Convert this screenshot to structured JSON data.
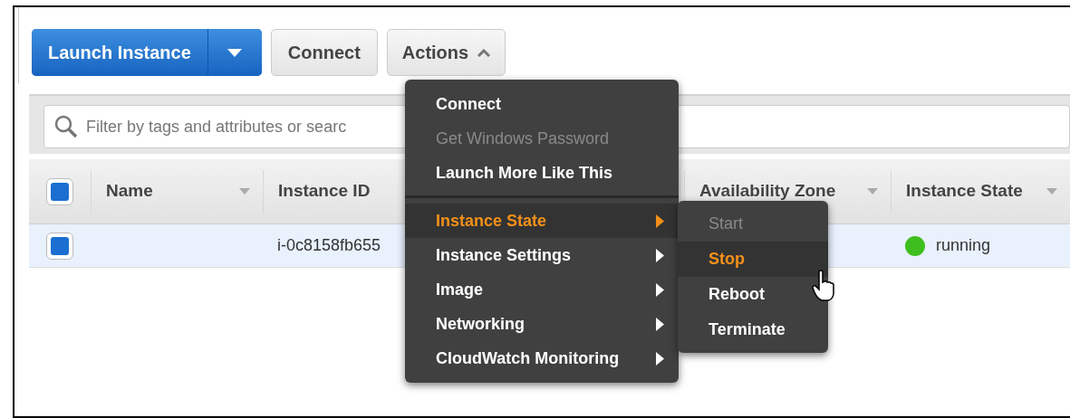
{
  "toolbar": {
    "launch_button": "Launch Instance",
    "connect_button": "Connect",
    "actions_button": "Actions",
    "actions_expanded": true
  },
  "filter": {
    "placeholder": "Filter by tags and attributes or searc"
  },
  "table": {
    "select_all_checked": true,
    "columns": [
      {
        "label": "Name",
        "sort_icon": true
      },
      {
        "label": "Instance ID",
        "sort_icon": false
      },
      {
        "label": "Availability Zone",
        "sort_icon": true
      },
      {
        "label": "Instance State",
        "sort_icon": true
      }
    ],
    "rows": [
      {
        "checked": true,
        "selected": true,
        "instance_id": "i-0c8158fb655",
        "state": "running"
      }
    ]
  },
  "actions_menu": [
    {
      "label": "Connect",
      "disabled": false,
      "selected": false,
      "has_submenu": false,
      "separator_before": false
    },
    {
      "label": "Get Windows Password",
      "disabled": true,
      "selected": false,
      "has_submenu": false,
      "separator_before": false
    },
    {
      "label": "Launch More Like This",
      "disabled": false,
      "selected": false,
      "has_submenu": false,
      "separator_before": false
    },
    {
      "label": "Instance State",
      "disabled": false,
      "selected": true,
      "has_submenu": true,
      "separator_before": true
    },
    {
      "label": "Instance Settings",
      "disabled": false,
      "selected": false,
      "has_submenu": true,
      "separator_before": false
    },
    {
      "label": "Image",
      "disabled": false,
      "selected": false,
      "has_submenu": true,
      "separator_before": false
    },
    {
      "label": "Networking",
      "disabled": false,
      "selected": false,
      "has_submenu": true,
      "separator_before": false
    },
    {
      "label": "CloudWatch Monitoring",
      "disabled": false,
      "selected": false,
      "has_submenu": true,
      "separator_before": false
    }
  ],
  "state_submenu": [
    {
      "label": "Start",
      "disabled": true,
      "selected": false
    },
    {
      "label": "Stop",
      "disabled": false,
      "selected": true
    },
    {
      "label": "Reboot",
      "disabled": false,
      "selected": false
    },
    {
      "label": "Terminate",
      "disabled": false,
      "selected": false
    }
  ]
}
